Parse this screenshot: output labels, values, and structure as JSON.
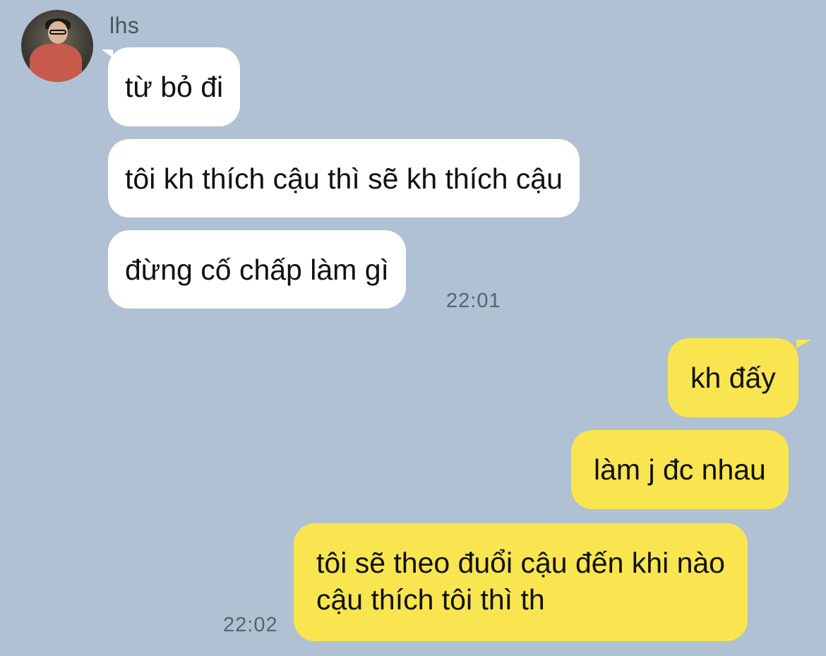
{
  "colors": {
    "background": "#afc1d2",
    "incoming_bubble": "#ffffff",
    "outgoing_bubble": "#f9e54f",
    "timestamp": "#59636d"
  },
  "contact": {
    "name": "lhs",
    "avatar_icon": "profile-photo"
  },
  "incoming": {
    "messages": [
      "từ bỏ đi",
      "tôi kh thích cậu thì sẽ kh thích cậu",
      "đừng cố chấp làm gì"
    ],
    "time": "22:01"
  },
  "outgoing": {
    "messages": [
      "kh đấy",
      "làm j đc nhau",
      [
        "tôi sẽ theo đuổi cậu đến khi nào",
        "cậu thích tôi thì th"
      ]
    ],
    "time": "22:02"
  }
}
